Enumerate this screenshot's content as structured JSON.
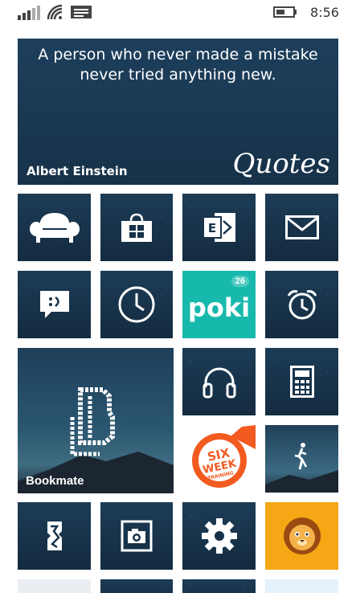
{
  "status_bar": {
    "time": "8:56",
    "icons": [
      "signal-icon",
      "wifi-icon",
      "message-icon",
      "battery-icon"
    ]
  },
  "quote_tile": {
    "quote": "A person who never made a mistake never tried anything new.",
    "author": "Albert Einstein",
    "app_name": "Quotes"
  },
  "tiles": {
    "row1": [
      "sofa-icon",
      "store-icon",
      "exchange-icon",
      "mail-icon"
    ],
    "row2": [
      "messaging-icon",
      "clock-icon",
      "poki",
      "alarm-icon"
    ],
    "poki": {
      "label": "poki",
      "badge": "26",
      "color": "#18b9ad"
    },
    "bookmate": {
      "label": "Bookmate"
    },
    "groove": "headphones-icon",
    "calculator": "calculator-icon",
    "six_week": {
      "line1": "SIX",
      "line2": "WEEK",
      "line3": "TRAINING"
    },
    "runner": "runner-icon",
    "row5": [
      "sketch-icon",
      "camera-icon",
      "settings-icon",
      "lion-icon"
    ]
  },
  "colors": {
    "tile_bg": "#17324a",
    "accent_teal": "#18b9ad",
    "accent_orange": "#f25a20",
    "lion_bg": "#f5a716"
  }
}
